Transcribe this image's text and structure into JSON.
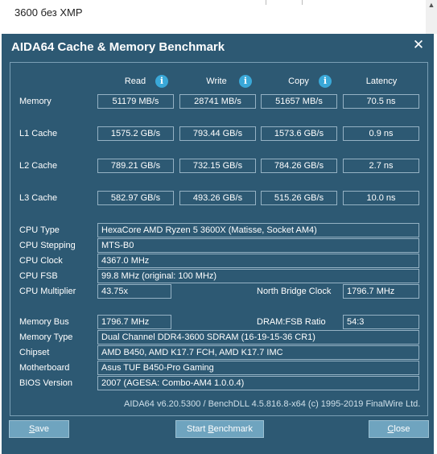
{
  "background_note": {
    "text": "3600 без XMP"
  },
  "window": {
    "title": "AIDA64 Cache & Memory Benchmark",
    "accent": "#2d5973"
  },
  "columns": {
    "read": "Read",
    "write": "Write",
    "copy": "Copy",
    "latency": "Latency"
  },
  "bench": {
    "memory": {
      "label": "Memory",
      "read": "51179 MB/s",
      "write": "28741 MB/s",
      "copy": "51657 MB/s",
      "latency": "70.5 ns"
    },
    "l1": {
      "label": "L1 Cache",
      "read": "1575.2 GB/s",
      "write": "793.44 GB/s",
      "copy": "1573.6 GB/s",
      "latency": "0.9 ns"
    },
    "l2": {
      "label": "L2 Cache",
      "read": "789.21 GB/s",
      "write": "732.15 GB/s",
      "copy": "784.26 GB/s",
      "latency": "2.7 ns"
    },
    "l3": {
      "label": "L3 Cache",
      "read": "582.97 GB/s",
      "write": "493.26 GB/s",
      "copy": "515.26 GB/s",
      "latency": "10.0 ns"
    }
  },
  "cpu": {
    "type": {
      "label": "CPU Type",
      "value": "HexaCore AMD Ryzen 5 3600X  (Matisse, Socket AM4)"
    },
    "stepping": {
      "label": "CPU Stepping",
      "value": "MTS-B0"
    },
    "clock": {
      "label": "CPU Clock",
      "value": "4367.0 MHz"
    },
    "fsb": {
      "label": "CPU FSB",
      "value": "99.8 MHz  (original: 100 MHz)"
    },
    "multiplier": {
      "label": "CPU Multiplier",
      "value": "43.75x"
    },
    "nb_clock": {
      "label": "North Bridge Clock",
      "value": "1796.7 MHz"
    }
  },
  "memory_info": {
    "bus": {
      "label": "Memory Bus",
      "value": "1796.7 MHz"
    },
    "ratio": {
      "label": "DRAM:FSB Ratio",
      "value": "54:3"
    },
    "type": {
      "label": "Memory Type",
      "value": "Dual Channel DDR4-3600 SDRAM  (16-19-15-36 CR1)"
    },
    "chipset": {
      "label": "Chipset",
      "value": "AMD B450, AMD K17.7 FCH, AMD K17.7 IMC"
    },
    "motherboard": {
      "label": "Motherboard",
      "value": "Asus TUF B450-Pro Gaming"
    },
    "bios": {
      "label": "BIOS Version",
      "value": "2007  (AGESA: Combo-AM4 1.0.0.4)"
    }
  },
  "footer": {
    "text": "AIDA64 v6.20.5300 / BenchDLL 4.5.816.8-x64  (c) 1995-2019 FinalWire Ltd."
  },
  "buttons": {
    "save": {
      "pre": "",
      "ul": "S",
      "post": "ave"
    },
    "start": {
      "pre": "Start ",
      "ul": "B",
      "post": "enchmark"
    },
    "close": {
      "pre": "",
      "ul": "C",
      "post": "lose"
    }
  },
  "icons": {
    "info": "info-icon",
    "close": "close-icon"
  }
}
